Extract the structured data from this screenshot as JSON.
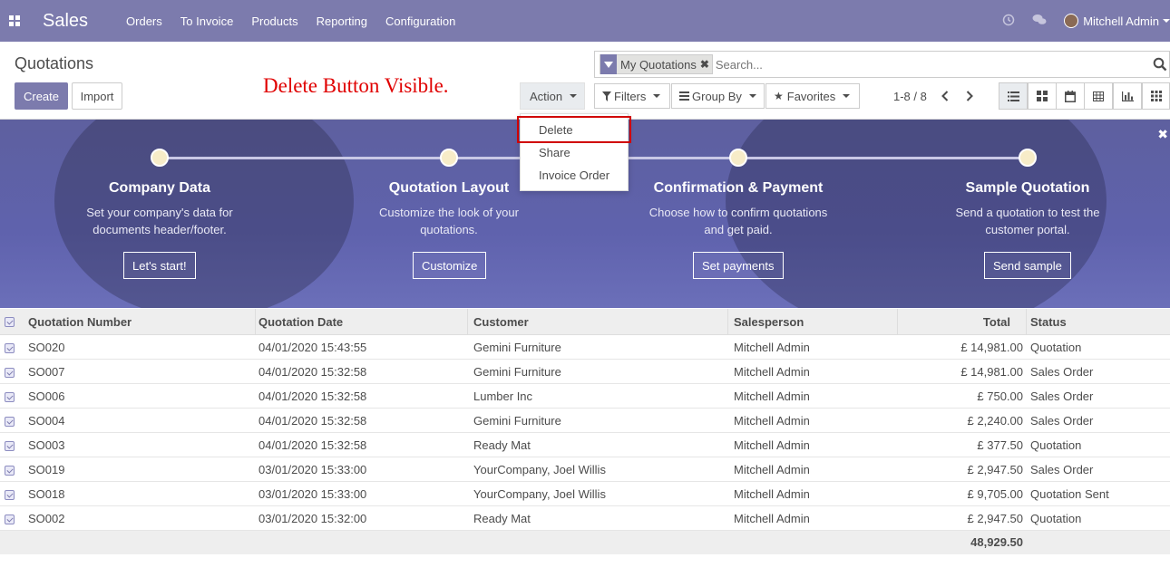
{
  "navbar": {
    "app_name": "Sales",
    "menu": [
      "Orders",
      "To Invoice",
      "Products",
      "Reporting",
      "Configuration"
    ],
    "user_name": "Mitchell Admin"
  },
  "control_panel": {
    "breadcrumb": "Quotations",
    "create_label": "Create",
    "import_label": "Import",
    "action_label": "Action",
    "annotation": "Delete Button Visible.",
    "search": {
      "facet_label": "My Quotations",
      "placeholder": "Search..."
    },
    "filters_label": "Filters",
    "group_by_label": "Group By",
    "favorites_label": "Favorites",
    "pager": "1-8 / 8"
  },
  "action_menu": [
    "Delete",
    "Share",
    "Invoice Order"
  ],
  "banner": {
    "steps": [
      {
        "title": "Company Data",
        "desc_line1": "Set your company's data for",
        "desc_line2": "documents header/footer.",
        "button": "Let's start!"
      },
      {
        "title": "Quotation Layout",
        "desc_line1": "Customize the look of your",
        "desc_line2": "quotations.",
        "button": "Customize"
      },
      {
        "title": "Confirmation & Payment",
        "desc_line1": "Choose how to confirm quotations",
        "desc_line2": "and get paid.",
        "button": "Set payments"
      },
      {
        "title": "Sample Quotation",
        "desc_line1": "Send a quotation to test the",
        "desc_line2": "customer portal.",
        "button": "Send sample"
      }
    ]
  },
  "table": {
    "headers": [
      "Quotation Number",
      "Quotation Date",
      "Customer",
      "Salesperson",
      "Total",
      "Status"
    ],
    "rows": [
      [
        "SO020",
        "04/01/2020 15:43:55",
        "Gemini Furniture",
        "Mitchell Admin",
        "£ 14,981.00",
        "Quotation"
      ],
      [
        "SO007",
        "04/01/2020 15:32:58",
        "Gemini Furniture",
        "Mitchell Admin",
        "£ 14,981.00",
        "Sales Order"
      ],
      [
        "SO006",
        "04/01/2020 15:32:58",
        "Lumber Inc",
        "Mitchell Admin",
        "£ 750.00",
        "Sales Order"
      ],
      [
        "SO004",
        "04/01/2020 15:32:58",
        "Gemini Furniture",
        "Mitchell Admin",
        "£ 2,240.00",
        "Sales Order"
      ],
      [
        "SO003",
        "04/01/2020 15:32:58",
        "Ready Mat",
        "Mitchell Admin",
        "£ 377.50",
        "Quotation"
      ],
      [
        "SO019",
        "03/01/2020 15:33:00",
        "YourCompany, Joel Willis",
        "Mitchell Admin",
        "£ 2,947.50",
        "Sales Order"
      ],
      [
        "SO018",
        "03/01/2020 15:33:00",
        "YourCompany, Joel Willis",
        "Mitchell Admin",
        "£ 9,705.00",
        "Quotation Sent"
      ],
      [
        "SO002",
        "03/01/2020 15:32:00",
        "Ready Mat",
        "Mitchell Admin",
        "£ 2,947.50",
        "Quotation"
      ]
    ],
    "footer_total": "48,929.50"
  }
}
